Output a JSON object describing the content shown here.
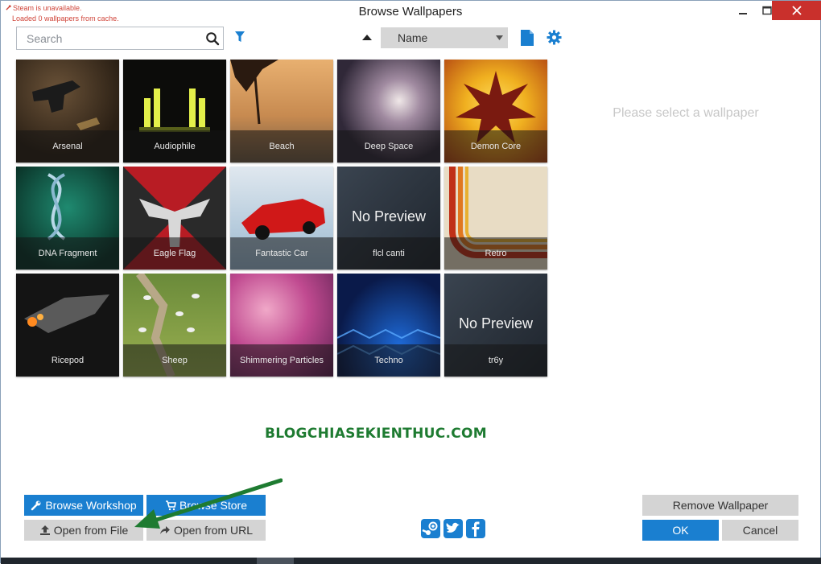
{
  "window": {
    "title": "Browse Wallpapers",
    "notices": [
      "Steam is unavailable.",
      "Loaded 0 wallpapers from cache."
    ]
  },
  "toolbar": {
    "search_placeholder": "Search",
    "sort_value": "Name"
  },
  "wallpapers": [
    {
      "name": "Arsenal",
      "preview": "image"
    },
    {
      "name": "Audiophile",
      "preview": "image"
    },
    {
      "name": "Beach",
      "preview": "image"
    },
    {
      "name": "Deep Space",
      "preview": "image"
    },
    {
      "name": "Demon Core",
      "preview": "image"
    },
    {
      "name": "DNA Fragment",
      "preview": "image"
    },
    {
      "name": "Eagle Flag",
      "preview": "image"
    },
    {
      "name": "Fantastic Car",
      "preview": "image"
    },
    {
      "name": "flcl canti",
      "preview": "none"
    },
    {
      "name": "Retro",
      "preview": "image"
    },
    {
      "name": "Ricepod",
      "preview": "image"
    },
    {
      "name": "Sheep",
      "preview": "image"
    },
    {
      "name": "Shimmering Particles",
      "preview": "image"
    },
    {
      "name": "Techno",
      "preview": "image"
    },
    {
      "name": "tr6y",
      "preview": "none"
    }
  ],
  "no_preview_label": "No Preview",
  "detail": {
    "empty_message": "Please select a wallpaper"
  },
  "watermark": "BLOGCHIASEKIENTHUC.COM",
  "buttons": {
    "browse_workshop": "Browse Workshop",
    "browse_store": "Browse Store",
    "open_from_file": "Open from File",
    "open_from_url": "Open from URL",
    "remove_wallpaper": "Remove Wallpaper",
    "ok": "OK",
    "cancel": "Cancel"
  },
  "social": [
    "steam-icon",
    "twitter-icon",
    "facebook-icon"
  ],
  "colors": {
    "accent": "#1a7fd0",
    "close": "#c9302c",
    "notice": "#d0453a",
    "watermark": "#1e7b31"
  }
}
